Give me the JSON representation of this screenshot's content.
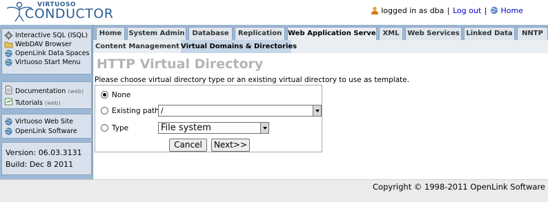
{
  "logo": {
    "line1": "VIRTUOSO",
    "line2": "CONDUCTOR"
  },
  "userbar": {
    "status": "logged in as dba",
    "logout": "Log out",
    "home": "Home",
    "sep": "|"
  },
  "sidebar": {
    "links": [
      {
        "label": "Interactive SQL (ISQL)",
        "icon": "sql-gear-icon"
      },
      {
        "label": "WebDAV Browser",
        "icon": "folder-icon"
      },
      {
        "label": "OpenLink Data Spaces",
        "icon": "globe-icon"
      },
      {
        "label": "Virtuoso Start Menu",
        "icon": "globe-icon"
      }
    ],
    "docs": [
      {
        "label": "Documentation",
        "meta": "(web)",
        "icon": "document-icon"
      },
      {
        "label": "Tutorials",
        "meta": "(web)",
        "icon": "tutorial-icon"
      }
    ],
    "sites": [
      {
        "label": "Virtuoso Web Site",
        "icon": "globe-icon"
      },
      {
        "label": "OpenLink Software",
        "icon": "globe-icon"
      }
    ],
    "version": "Version: 06.03.3131",
    "build": "Build: Dec 8 2011"
  },
  "tabs": [
    {
      "label": "Home"
    },
    {
      "label": "System Admin"
    },
    {
      "label": "Database"
    },
    {
      "label": "Replication"
    },
    {
      "label": "Web Application Server",
      "active": true
    },
    {
      "label": "XML"
    },
    {
      "label": "Web Services"
    },
    {
      "label": "Linked Data"
    },
    {
      "label": "NNTP"
    }
  ],
  "subtabs": [
    {
      "label": "Content Management"
    },
    {
      "label": "Virtual Domains & Directories",
      "active": true
    }
  ],
  "content": {
    "title": "HTTP Virtual Directory",
    "instruction": "Please choose virtual directory type or an existing virtual directory to use as template.",
    "options": [
      {
        "label": "None",
        "checked": true
      },
      {
        "label": "Existing path",
        "checked": false
      },
      {
        "label": "Type",
        "checked": false
      }
    ],
    "path_value": "/",
    "type_value": "File system",
    "cancel": "Cancel",
    "next": "Next>>"
  },
  "footer": {
    "copyright": "Copyright © 1998-2011 OpenLink Software"
  },
  "colors": {
    "accent": "#9db8d4",
    "title_gray": "#b4b4b4",
    "link": "#0000cc"
  }
}
